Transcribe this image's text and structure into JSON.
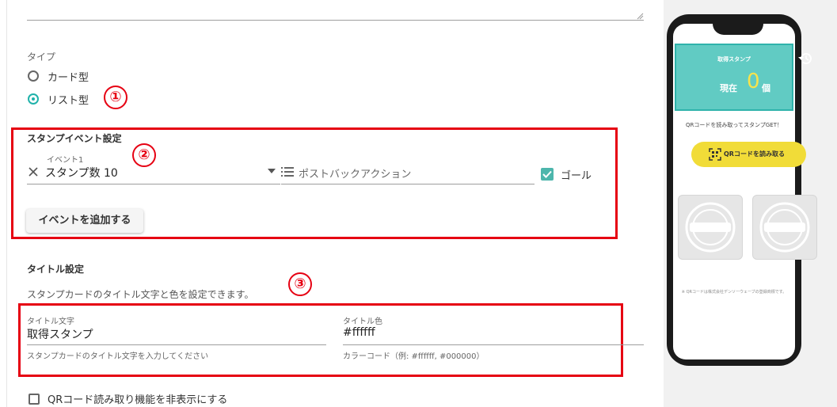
{
  "type_section": {
    "label": "タイプ",
    "options": [
      "カード型",
      "リスト型"
    ],
    "selected": "リスト型"
  },
  "markers": [
    "①",
    "②",
    "③"
  ],
  "stamp_event": {
    "heading": "スタンプイベント設定",
    "event_label": "イベント1",
    "event_value": "スタンプ数 10",
    "action_placeholder": "ポストバックアクション",
    "goal_label": "ゴール",
    "goal_checked": true,
    "add_button": "イベントを追加する"
  },
  "title_settings": {
    "heading": "タイトル設定",
    "description": "スタンプカードのタイトル文字と色を設定できます。",
    "title_text_label": "タイトル文字",
    "title_text_value": "取得スタンプ",
    "title_text_helper": "スタンプカードのタイトル文字を入力してください",
    "title_color_label": "タイトル色",
    "title_color_value": "#ffffff",
    "title_color_helper": "カラーコード（例: #ffffff, #000000）"
  },
  "qr_hide_option": {
    "label": "QRコード読み取り機能を非表示にする",
    "checked": false
  },
  "preview": {
    "header_title": "取得スタンプ",
    "count_prefix": "現在",
    "count_value": "0",
    "count_suffix": "個",
    "instruction": "QRコードを読み取ってスタンプGET！",
    "qr_button": "QRコードを読み取る",
    "footnote": "※ QRコードは株式会社デンソーウェーブの登録商標です。"
  },
  "colors": {
    "accent_teal": "#61cbc3",
    "radio_checked": "#20b2aa",
    "highlight_red": "#e60012",
    "count_yellow": "#f7e34c",
    "qr_button_yellow": "#f1dc38"
  }
}
